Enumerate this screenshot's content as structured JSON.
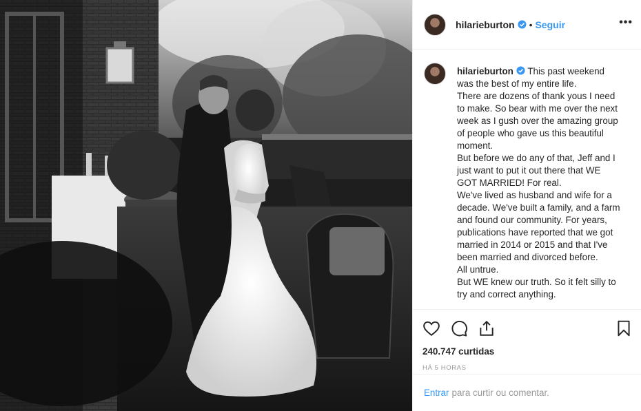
{
  "post": {
    "username": "hilarieburton",
    "separator": "•",
    "follow_label": "Seguir",
    "more_label": "•••",
    "caption": "This past weekend was the best of my entire life.\nThere are dozens of thank yous I need to make. So bear with me over the next week as I gush over the amazing group of people who gave us this beautiful moment.\nBut before we do any of that, Jeff and I just want to put it out there that WE GOT MARRIED! For real.\nWe've lived as husband and wife for a decade. We've built a family, and a farm and found our community. For years, publications have reported that we got married in 2014 or 2015 and that I've been married and divorced before.\nAll untrue.\nBut WE knew our truth. So it felt silly to try and correct anything.",
    "likes": "240.747 curtidas",
    "timestamp": "HÁ 5 HORAS",
    "comment": {
      "login_label": "Entrar",
      "prompt": "para curtir ou comentar."
    }
  },
  "icons": {
    "verified": "verified-badge-icon",
    "like": "heart-icon",
    "comment": "comment-bubble-icon",
    "share": "share-icon",
    "save": "bookmark-icon"
  },
  "colors": {
    "link": "#3897f0",
    "text": "#262626",
    "muted": "#999999",
    "border": "#efefef"
  }
}
